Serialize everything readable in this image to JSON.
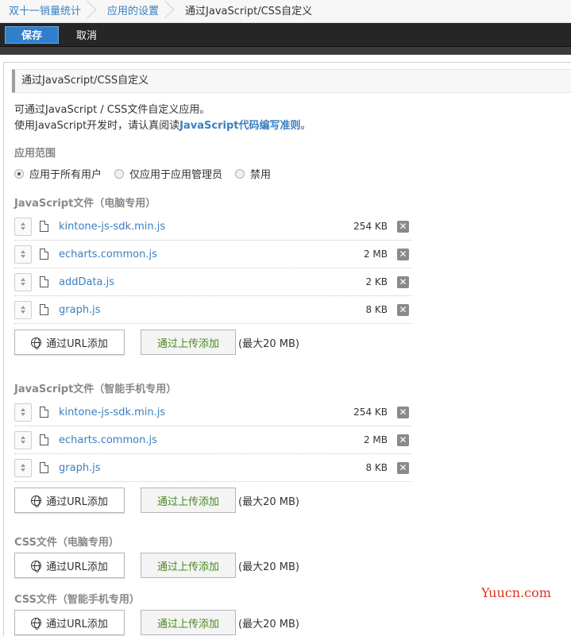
{
  "breadcrumb": [
    "双十一销量统计",
    "应用的设置",
    "通过JavaScript/CSS自定义"
  ],
  "toolbar": {
    "save_label": "保存",
    "cancel_label": "取消"
  },
  "section": {
    "title": "通过JavaScript/CSS自定义",
    "intro_line1": "可通过JavaScript / CSS文件自定义应用。",
    "intro_line2_prefix": "使用JavaScript开发时，请认真阅读",
    "intro_link": "JavaScript代码编写准则",
    "intro_line2_suffix": "。"
  },
  "scope": {
    "title": "应用范围",
    "options": [
      "应用于所有用户",
      "仅应用于应用管理员",
      "禁用"
    ],
    "selected": 0
  },
  "groups": [
    {
      "title": "JavaScript文件（电脑专用）",
      "files": [
        {
          "name": "kintone-js-sdk.min.js",
          "size": "254 KB"
        },
        {
          "name": "echarts.common.js",
          "size": "2 MB"
        },
        {
          "name": "addData.js",
          "size": "2 KB"
        },
        {
          "name": "graph.js",
          "size": "8 KB"
        }
      ]
    },
    {
      "title": "JavaScript文件（智能手机专用）",
      "files": [
        {
          "name": "kintone-js-sdk.min.js",
          "size": "254 KB"
        },
        {
          "name": "echarts.common.js",
          "size": "2 MB"
        },
        {
          "name": "graph.js",
          "size": "8 KB"
        }
      ]
    },
    {
      "title": "CSS文件（电脑专用）",
      "files": []
    },
    {
      "title": "CSS文件（智能手机专用）",
      "files": []
    }
  ],
  "add_buttons": {
    "url_label": "通过URL添加",
    "upload_label": "通过上传添加",
    "max_note": "(最大20 MB)"
  },
  "watermark": "Yuucn.com",
  "icons": {
    "globe": "globe-icon",
    "file": "file-icon",
    "delete": "delete-icon",
    "sort": "sort-handle-icon"
  },
  "colors": {
    "link": "#3a7fc1",
    "save_button": "#2f7fcc",
    "upload_text": "#4b8a1f",
    "toolbar": "#262626"
  }
}
